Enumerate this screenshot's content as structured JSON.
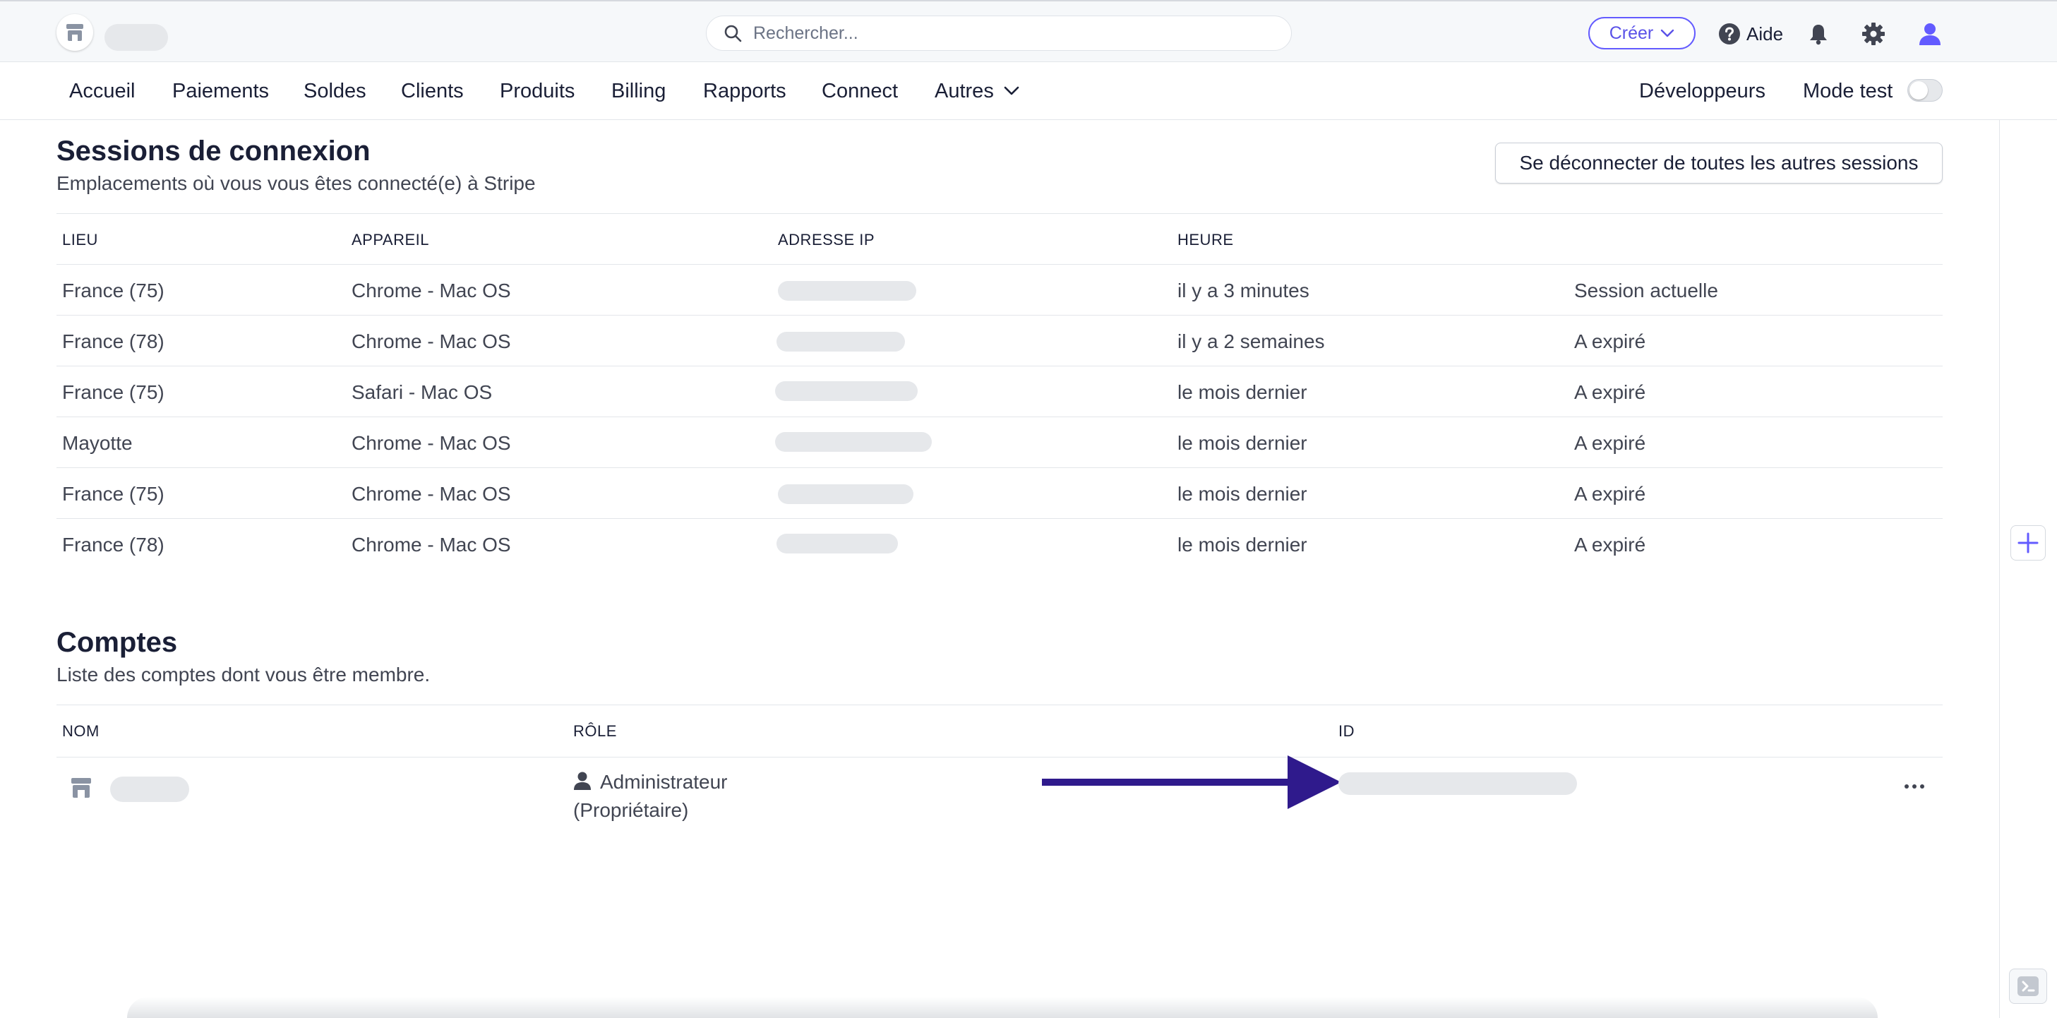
{
  "header": {
    "search_placeholder": "Rechercher...",
    "create_label": "Créer",
    "help_label": "Aide"
  },
  "nav": {
    "items": [
      "Accueil",
      "Paiements",
      "Soldes",
      "Clients",
      "Produits",
      "Billing",
      "Rapports",
      "Connect",
      "Autres"
    ],
    "developers_label": "Développeurs",
    "test_mode_label": "Mode test",
    "test_mode_on": false
  },
  "sessions": {
    "title": "Sessions de connexion",
    "subtitle": "Emplacements où vous vous êtes connecté(e) à Stripe",
    "logout_all_label": "Se déconnecter de toutes les autres sessions",
    "columns": [
      "LIEU",
      "APPAREIL",
      "ADRESSE IP",
      "HEURE"
    ],
    "rows": [
      {
        "location": "France (75)",
        "device": "Chrome - Mac OS",
        "time": "il y a 3 minutes",
        "status": "Session actuelle"
      },
      {
        "location": "France (78)",
        "device": "Chrome - Mac OS",
        "time": "il y a 2 semaines",
        "status": "A expiré"
      },
      {
        "location": "France (75)",
        "device": "Safari - Mac OS",
        "time": "le mois dernier",
        "status": "A expiré"
      },
      {
        "location": "Mayotte",
        "device": "Chrome - Mac OS",
        "time": "le mois dernier",
        "status": "A expiré"
      },
      {
        "location": "France (75)",
        "device": "Chrome - Mac OS",
        "time": "le mois dernier",
        "status": "A expiré"
      },
      {
        "location": "France (78)",
        "device": "Chrome - Mac OS",
        "time": "le mois dernier",
        "status": "A expiré"
      }
    ]
  },
  "accounts": {
    "title": "Comptes",
    "subtitle": "Liste des comptes dont vous être membre.",
    "columns": [
      "NOM",
      "RÔLE",
      "ID"
    ],
    "rows": [
      {
        "role_line1": "Administrateur",
        "role_line2": "(Propriétaire)"
      }
    ]
  },
  "colors": {
    "accent": "#635bff",
    "arrow": "#2f1a8c",
    "redacted": "#e6e8eb"
  },
  "icons": [
    "store-icon",
    "search-icon",
    "chevron-down-icon",
    "help-icon",
    "bell-icon",
    "gear-icon",
    "user-icon",
    "plus-icon",
    "terminal-icon",
    "more-icon"
  ]
}
